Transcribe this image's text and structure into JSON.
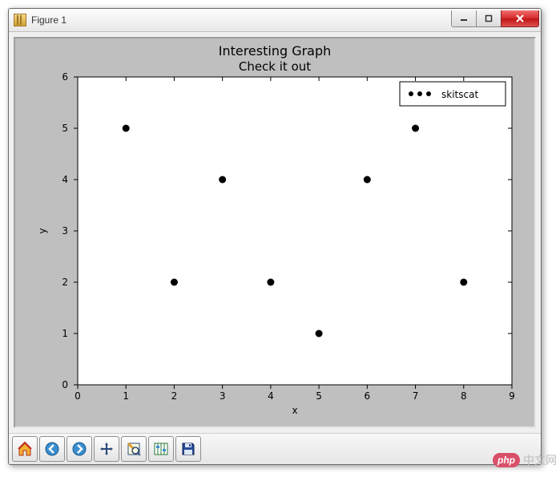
{
  "window": {
    "title": "Figure 1"
  },
  "chart_data": {
    "type": "scatter",
    "title": "Interesting Graph",
    "subtitle": "Check it out",
    "xlabel": "x",
    "ylabel": "y",
    "xlim": [
      0,
      9
    ],
    "ylim": [
      0,
      6
    ],
    "xticks": [
      0,
      1,
      2,
      3,
      4,
      5,
      6,
      7,
      8,
      9
    ],
    "yticks": [
      0,
      1,
      2,
      3,
      4,
      5,
      6
    ],
    "legend_position": "upper right",
    "series": [
      {
        "name": "skitscat",
        "marker": "dot",
        "color": "#000000",
        "x": [
          1,
          2,
          3,
          4,
          5,
          6,
          7,
          8
        ],
        "y": [
          5,
          2,
          4,
          2,
          1,
          4,
          5,
          2
        ]
      }
    ]
  },
  "toolbar": {
    "items": [
      "home-icon",
      "back-icon",
      "forward-icon",
      "pan-icon",
      "zoom-icon",
      "configure-icon",
      "save-icon"
    ]
  },
  "watermark": {
    "badge": "php",
    "text": "中文网"
  }
}
